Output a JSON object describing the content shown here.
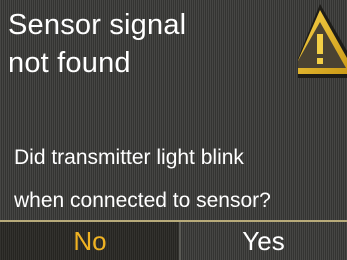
{
  "alert": {
    "title_line1": "Sensor signal",
    "title_line2": "not found",
    "icon": "warning-icon",
    "question_line1": "Did transmitter light blink",
    "question_line2": "when connected to sensor?"
  },
  "softkeys": {
    "left_label": "No",
    "right_label": "Yes",
    "selected": "No"
  },
  "colors": {
    "background": "#3a3a38",
    "selected_text": "#f0b323",
    "text": "#ffffff",
    "warning": "#e3b21a"
  }
}
